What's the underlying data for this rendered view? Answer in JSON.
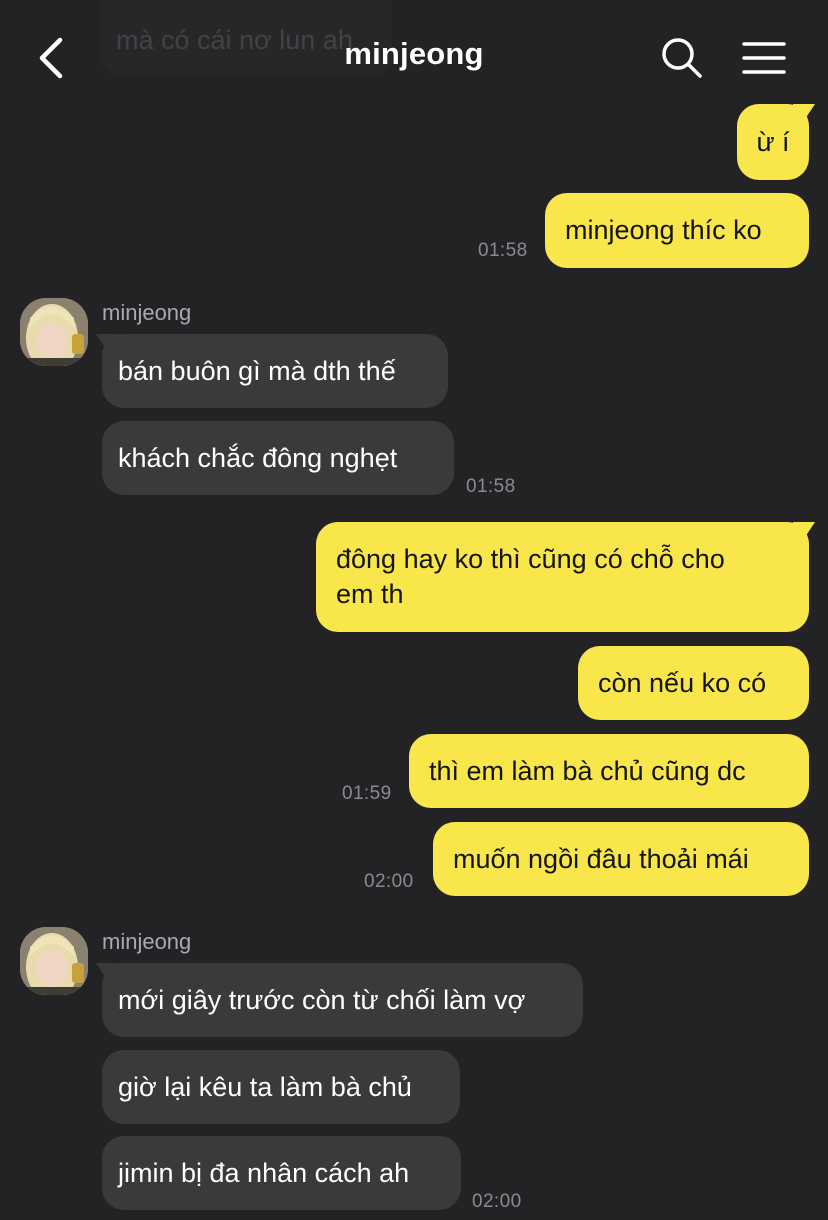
{
  "header": {
    "title": "minjeong",
    "ghost_message": "mà có cái nơ lun ah",
    "back_icon": "chevron-left-icon",
    "search_icon": "search-icon",
    "menu_icon": "menu-icon"
  },
  "colors": {
    "background": "#232325",
    "outgoing": "#f9e64b",
    "incoming": "#3a3a3c"
  },
  "messages": {
    "m1": {
      "text": "ừ í"
    },
    "m2": {
      "text": "minjeong thíc ko",
      "time": "01:58"
    },
    "g1": {
      "sender": "minjeong",
      "m3": "bán buôn gì mà dth thế",
      "m4": "khách chắc đông nghẹt",
      "time": "01:58"
    },
    "m5": {
      "line1": "đông hay ko thì cũng có chỗ cho",
      "line2": "em th"
    },
    "m6": {
      "text": "còn nếu ko có"
    },
    "m7": {
      "text": "thì em làm bà chủ cũng dc",
      "time": "01:59"
    },
    "m8": {
      "text": "muốn ngồi đâu thoải mái",
      "time": "02:00"
    },
    "g2": {
      "sender": "minjeong",
      "m9": "mới giây trước còn từ chối làm vợ",
      "m10": "giờ lại kêu ta làm bà chủ",
      "m11": "jimin bị đa nhân cách ah",
      "time": "02:00"
    }
  }
}
